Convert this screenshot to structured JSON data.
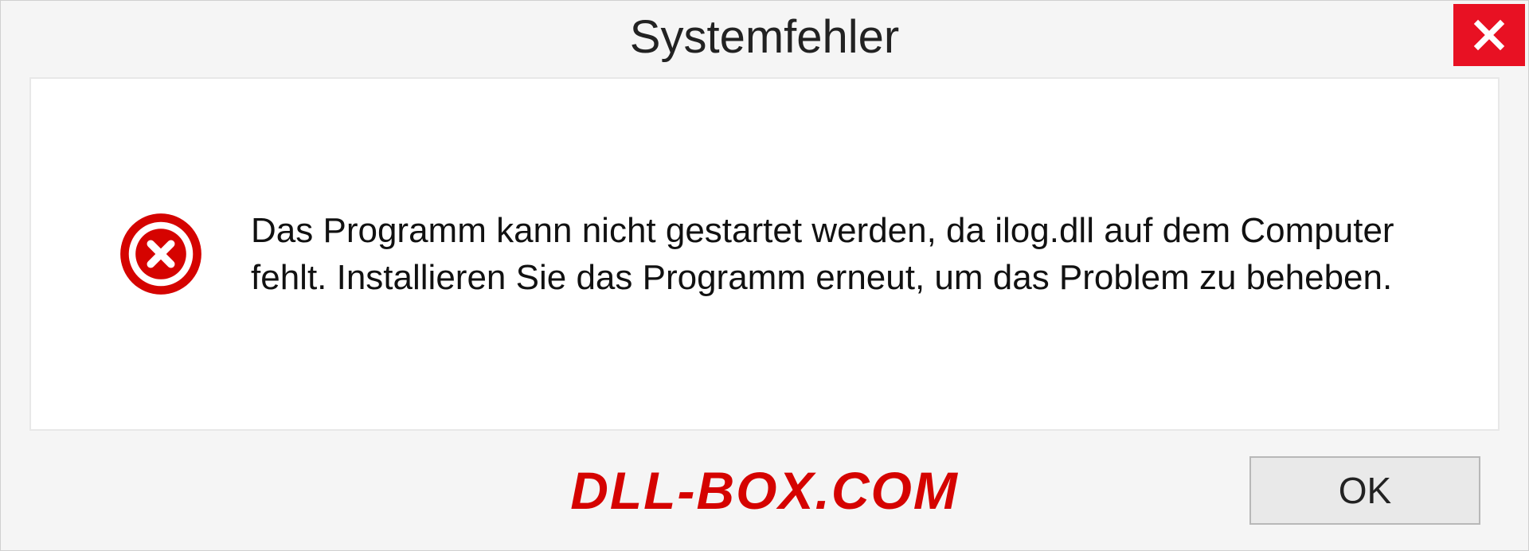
{
  "dialog": {
    "title": "Systemfehler",
    "message": "Das Programm kann nicht gestartet werden, da ilog.dll auf dem Computer fehlt. Installieren Sie das Programm erneut, um das Problem zu beheben.",
    "ok_label": "OK"
  },
  "watermark": "DLL-BOX.COM"
}
